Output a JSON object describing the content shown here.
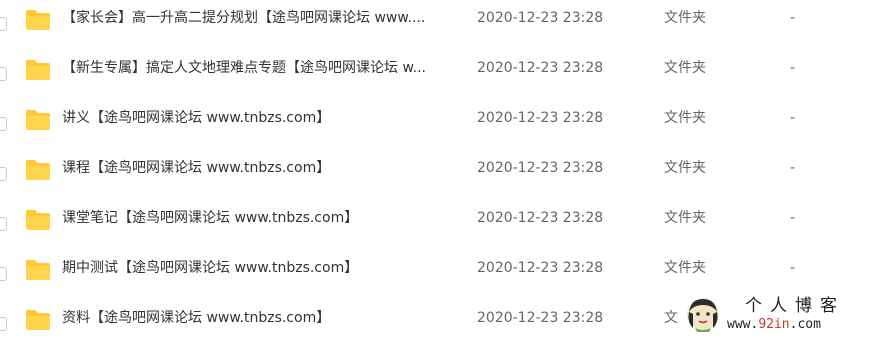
{
  "file_list": {
    "rows": [
      {
        "name": "【家长会】高一升高二提分规划【途鸟吧网课论坛 www....",
        "date": "2020-12-23 23:28",
        "type": "文件夹",
        "size": "-"
      },
      {
        "name": "【新生专属】搞定人文地理难点专题【途鸟吧网课论坛 w...",
        "date": "2020-12-23 23:28",
        "type": "文件夹",
        "size": "-"
      },
      {
        "name": "讲义【途鸟吧网课论坛 www.tnbzs.com】",
        "date": "2020-12-23 23:28",
        "type": "文件夹",
        "size": "-"
      },
      {
        "name": "课程【途鸟吧网课论坛 www.tnbzs.com】",
        "date": "2020-12-23 23:28",
        "type": "文件夹",
        "size": "-"
      },
      {
        "name": "课堂笔记【途鸟吧网课论坛 www.tnbzs.com】",
        "date": "2020-12-23 23:28",
        "type": "文件夹",
        "size": "-"
      },
      {
        "name": "期中测试【途鸟吧网课论坛 www.tnbzs.com】",
        "date": "2020-12-23 23:28",
        "type": "文件夹",
        "size": "-"
      },
      {
        "name": "资料【途鸟吧网课论坛 www.tnbzs.com】",
        "date": "2020-12-23 23:28",
        "type": "文",
        "size": ""
      }
    ],
    "folder_icon": "folder-icon",
    "folder_color": "#ffd040"
  },
  "watermark": {
    "title": "个人博客",
    "url_prefix": "www.",
    "url_accent": "92in",
    "url_suffix": ".com",
    "icon": "avatar-icon"
  }
}
